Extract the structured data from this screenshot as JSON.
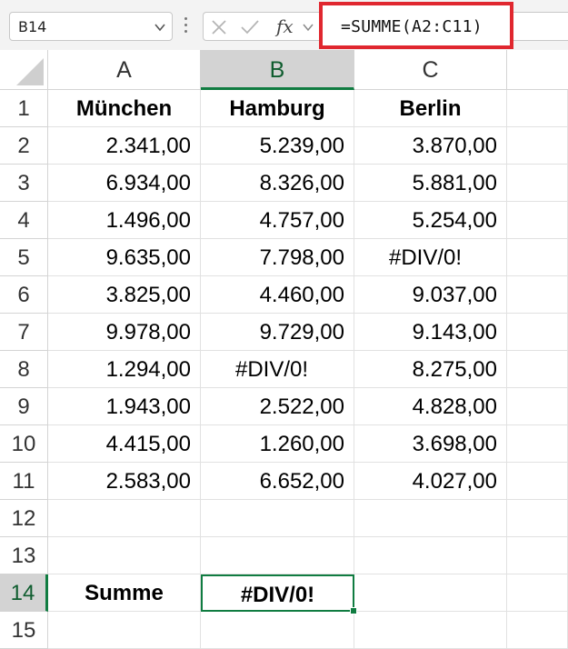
{
  "formula_bar": {
    "name_box": "B14",
    "fx_label": "fx",
    "formula": "=SUMME(A2:C11)"
  },
  "columns": [
    "A",
    "B",
    "C",
    ""
  ],
  "rows": [
    "1",
    "2",
    "3",
    "4",
    "5",
    "6",
    "7",
    "8",
    "9",
    "10",
    "11",
    "12",
    "13",
    "14",
    "15"
  ],
  "headers": [
    "München",
    "Hamburg",
    "Berlin"
  ],
  "data": [
    [
      "2.341,00",
      "5.239,00",
      "3.870,00"
    ],
    [
      "6.934,00",
      "8.326,00",
      "5.881,00"
    ],
    [
      "1.496,00",
      "4.757,00",
      "5.254,00"
    ],
    [
      "9.635,00",
      "7.798,00",
      "#DIV/0!"
    ],
    [
      "3.825,00",
      "4.460,00",
      "9.037,00"
    ],
    [
      "9.978,00",
      "9.729,00",
      "9.143,00"
    ],
    [
      "1.294,00",
      "#DIV/0!",
      "8.275,00"
    ],
    [
      "1.943,00",
      "2.522,00",
      "4.828,00"
    ],
    [
      "4.415,00",
      "1.260,00",
      "3.698,00"
    ],
    [
      "2.583,00",
      "6.652,00",
      "4.027,00"
    ]
  ],
  "summary": {
    "label": "Summe",
    "value": "#DIV/0!"
  },
  "selection": {
    "column": "B",
    "row": "14"
  },
  "colors": {
    "accent": "#107c41",
    "highlight_box": "#e0272f"
  }
}
